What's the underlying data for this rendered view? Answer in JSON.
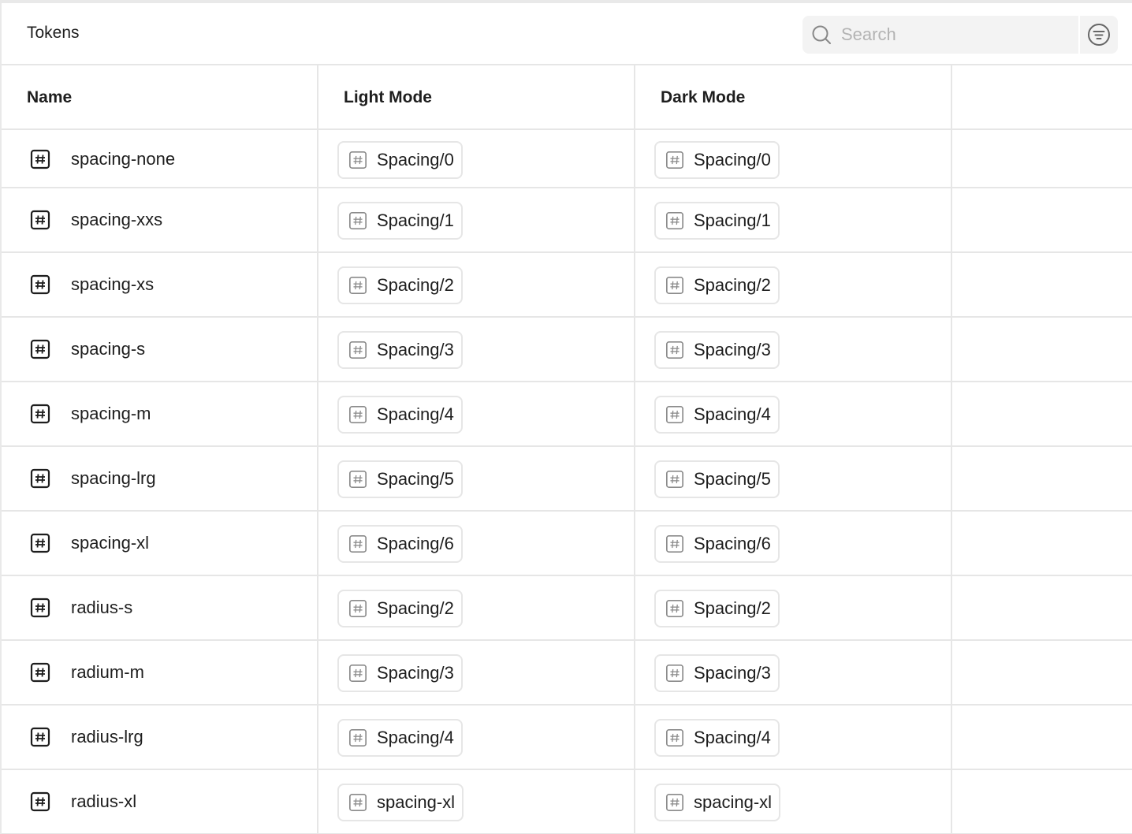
{
  "header": {
    "title": "Tokens",
    "search_placeholder": "Search",
    "search_icon": "search-icon",
    "filter_icon": "filter-icon"
  },
  "table": {
    "columns": [
      "Name",
      "Light Mode",
      "Dark Mode"
    ],
    "rows": [
      {
        "name": "spacing-none",
        "light": "Spacing/0",
        "dark": "Spacing/0"
      },
      {
        "name": "spacing-xxs",
        "light": "Spacing/1",
        "dark": "Spacing/1"
      },
      {
        "name": "spacing-xs",
        "light": "Spacing/2",
        "dark": "Spacing/2"
      },
      {
        "name": "spacing-s",
        "light": "Spacing/3",
        "dark": "Spacing/3"
      },
      {
        "name": "spacing-m",
        "light": "Spacing/4",
        "dark": "Spacing/4"
      },
      {
        "name": "spacing-lrg",
        "light": "Spacing/5",
        "dark": "Spacing/5"
      },
      {
        "name": "spacing-xl",
        "light": "Spacing/6",
        "dark": "Spacing/6"
      },
      {
        "name": "radius-s",
        "light": "Spacing/2",
        "dark": "Spacing/2"
      },
      {
        "name": "radium-m",
        "light": "Spacing/3",
        "dark": "Spacing/3"
      },
      {
        "name": "radius-lrg",
        "light": "Spacing/4",
        "dark": "Spacing/4"
      },
      {
        "name": "radius-xl",
        "light": "spacing-xl",
        "dark": "spacing-xl"
      }
    ]
  },
  "colors": {
    "border": "#e6e6e6",
    "text": "#1e1e1e",
    "placeholder": "#b3b3b3",
    "search_bg": "#f3f3f3"
  }
}
